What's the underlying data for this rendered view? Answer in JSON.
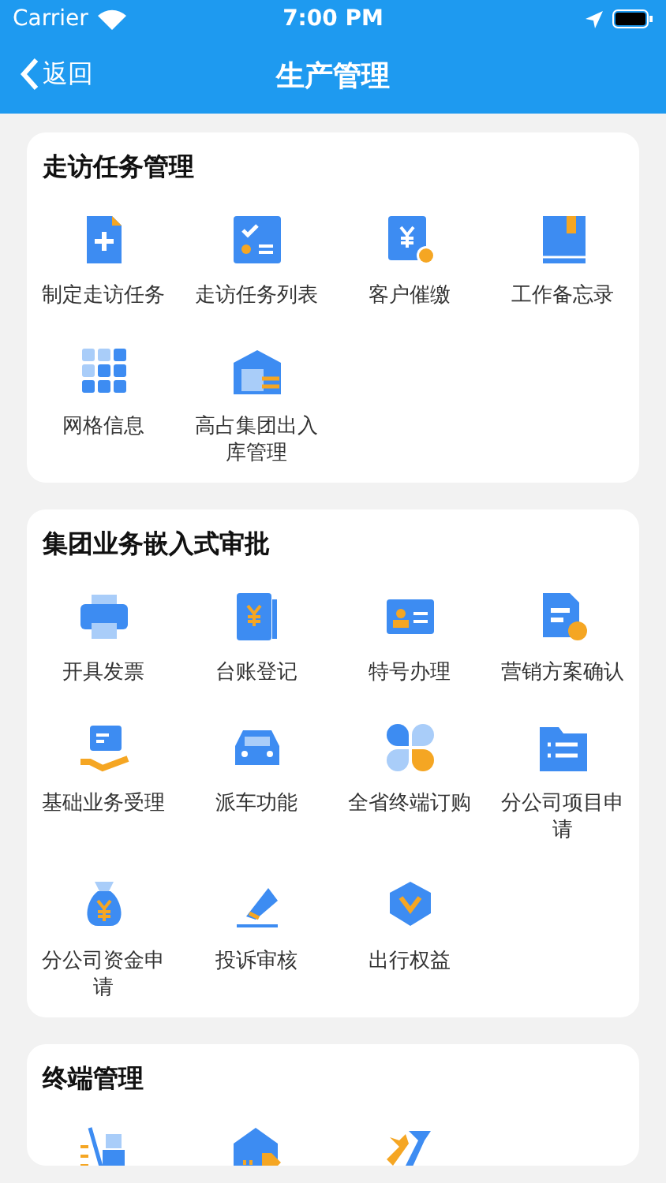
{
  "status_bar": {
    "carrier": "Carrier",
    "time": "7:00 PM"
  },
  "nav": {
    "back": "返回",
    "title": "生产管理"
  },
  "sections": [
    {
      "title": "走访任务管理",
      "items": [
        {
          "label": "制定走访任务"
        },
        {
          "label": "走访任务列表"
        },
        {
          "label": "客户催缴"
        },
        {
          "label": "工作备忘录"
        },
        {
          "label": "网格信息"
        },
        {
          "label": "高占集团出入库管理"
        }
      ]
    },
    {
      "title": "集团业务嵌入式审批",
      "items": [
        {
          "label": "开具发票"
        },
        {
          "label": "台账登记"
        },
        {
          "label": "特号办理"
        },
        {
          "label": "营销方案确认"
        },
        {
          "label": "基础业务受理"
        },
        {
          "label": "派车功能"
        },
        {
          "label": "全省终端订购"
        },
        {
          "label": "分公司项目申请"
        },
        {
          "label": "分公司资金申请"
        },
        {
          "label": "投诉审核"
        },
        {
          "label": "出行权益"
        }
      ]
    },
    {
      "title": "终端管理",
      "items": [
        {
          "kind": "icon"
        },
        {
          "kind": "icon"
        },
        {
          "kind": "icon"
        }
      ]
    }
  ]
}
